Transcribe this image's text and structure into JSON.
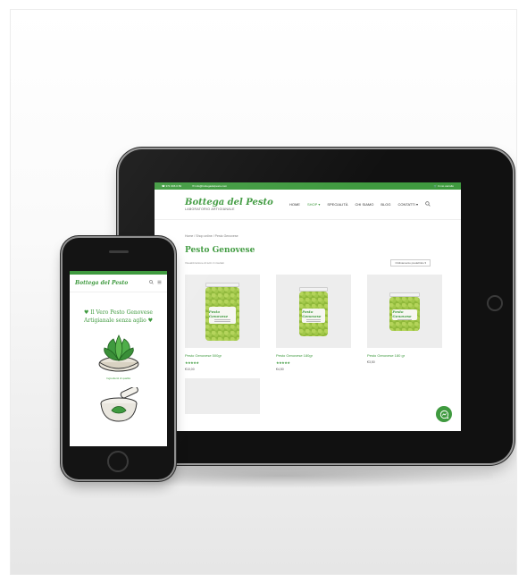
{
  "tablet": {
    "topbar": {
      "phone": "☎ 371 966 0 83",
      "email": "✉ info@bottegadelpesto.com",
      "cart": "🛒 Il mio carrello"
    },
    "logo": {
      "name": "Bottega del Pesto",
      "tagline": "LABORATORIO ARTIGIANALE"
    },
    "nav": [
      "HOME",
      "SHOP ▾",
      "SPECIALITÀ",
      "CHI SIAMO",
      "BLOG",
      "CONTATTI ▾"
    ],
    "breadcrumb": "Home / Shop online / Pesto Genovese",
    "page_title": "Pesto Genovese",
    "results_count": "Visualizzazione di tutti i 4 risultati",
    "sort_label": "Ordinamento predefinito ▾",
    "products": [
      {
        "name": "Pesto Genovese 500gr",
        "stars": "★★★★★",
        "price": "€10,00",
        "jar_label": "Pesto Genovese"
      },
      {
        "name": "Pesto Genovese 180gr",
        "stars": "★★★★★",
        "price": "€4,50",
        "jar_label": "Pesto Genovese"
      },
      {
        "name": "Pesto Genovese 180 gr",
        "stars": "",
        "price": "€3,50",
        "jar_label": "Pesto Genovese"
      }
    ]
  },
  "phone": {
    "logo": "Bottega del Pesto",
    "hero_line1": "♥ Il Vero Pesto Genovese",
    "hero_line2": "Artigianale senza aglio ♥",
    "caption": "Ingredienti di qualità",
    "icons": [
      "search-icon",
      "menu-icon"
    ]
  },
  "colors": {
    "brand": "#3f9a3f",
    "pesto": "#8fb83a"
  }
}
